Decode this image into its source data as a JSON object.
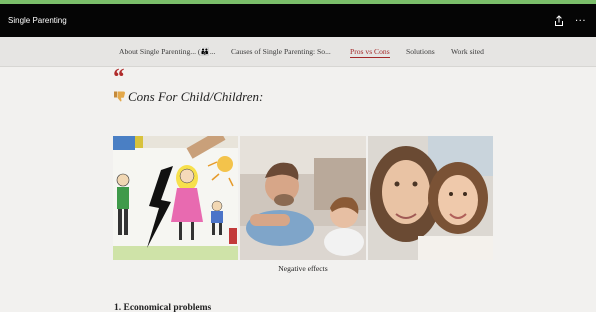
{
  "app": {
    "title": "Single Parenting"
  },
  "toolbar": {
    "share_icon": "share-icon",
    "more_icon": "more-icon",
    "more_glyph": "···"
  },
  "nav": {
    "items": [
      {
        "label": "About Single Parenting... (👪..."
      },
      {
        "label": "Causes of Single Parenting: So..."
      },
      {
        "label": "Pros vs Cons",
        "active": true
      },
      {
        "label": "Solutions"
      },
      {
        "label": "Work sited"
      }
    ]
  },
  "content": {
    "quote_mark": "“",
    "heading": "Cons For Child/Children:",
    "heading_icon": "thumbs-down-icon",
    "gallery_caption": "Negative effects",
    "section_heading": "1. Economical problems"
  },
  "colors": {
    "accent": "#a32929",
    "titlebar": "#050505",
    "navbar": "#e6e5e3",
    "background": "#f2f1ef"
  }
}
